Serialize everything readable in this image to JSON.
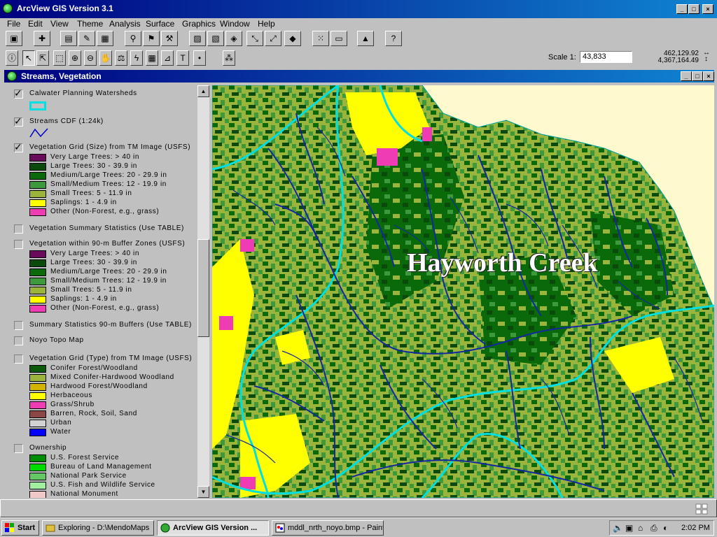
{
  "app": {
    "title": "ArcView GIS Version 3.1",
    "min": "_",
    "max": "□",
    "close": "×"
  },
  "menu": [
    "File",
    "Edit",
    "View",
    "Theme",
    "Analysis",
    "Surface",
    "Graphics",
    "Window",
    "Help"
  ],
  "toolbar": {
    "scale_label": "Scale 1:",
    "scale_value": "43,833",
    "coord_x": "462,129.92",
    "coord_y": "4,367,164.49"
  },
  "view": {
    "title": "Streams, Vegetation",
    "map_label": "Hayworth Creek",
    "themes": [
      {
        "name": "Calwater Planning Watersheds",
        "checked": true
      },
      {
        "name": "Streams CDF (1:24k)",
        "checked": true
      },
      {
        "name": "Vegetation Grid (Size) from TM Image (USFS)",
        "checked": true,
        "legend": [
          {
            "label": "Very Large Trees: > 40  in",
            "color": "#6a0a5a"
          },
          {
            "label": "Large Trees: 30 - 39.9 in",
            "color": "#0a4a0a"
          },
          {
            "label": "Medium/Large Trees: 20 - 29.9 in",
            "color": "#0a6a0a"
          },
          {
            "label": "Small/Medium Trees: 12 - 19.9 in",
            "color": "#3c9a3c"
          },
          {
            "label": "Small Trees: 5 - 11.9 in",
            "color": "#9ab43c"
          },
          {
            "label": "Saplings: 1 - 4.9 in",
            "color": "#ffff00"
          },
          {
            "label": "Other (Non-Forest, e.g., grass)",
            "color": "#f03cb4"
          }
        ]
      },
      {
        "name": "Vegetation Summary Statistics (Use TABLE)",
        "checked": false
      },
      {
        "name": "Vegetation within 90-m Buffer Zones (USFS)",
        "checked": false,
        "legend": [
          {
            "label": "Very Large Trees: > 40  in",
            "color": "#6a0a5a"
          },
          {
            "label": "Large Trees: 30 - 39.9 in",
            "color": "#0a4a0a"
          },
          {
            "label": "Medium/Large Trees: 20 - 29.9 in",
            "color": "#0a6a0a"
          },
          {
            "label": "Small/Medium Trees: 12 - 19.9 in",
            "color": "#3c9a3c"
          },
          {
            "label": "Small Trees: 5 - 11.9 in",
            "color": "#9ab43c"
          },
          {
            "label": "Saplings: 1 - 4.9 in",
            "color": "#ffff00"
          },
          {
            "label": "Other (Non-Forest, e.g., grass)",
            "color": "#f03cb4"
          }
        ]
      },
      {
        "name": "Summary Statistics 90-m Buffers (Use TABLE)",
        "checked": false
      },
      {
        "name": "Noyo Topo Map",
        "checked": false
      },
      {
        "name": "Vegetation Grid (Type) from TM Image (USFS)",
        "checked": false,
        "legend": [
          {
            "label": "Conifer Forest/Woodland",
            "color": "#0a5a0a"
          },
          {
            "label": "Mixed Conifer-Hardwood Woodland",
            "color": "#9ab43c"
          },
          {
            "label": "Hardwood Forest/Woodland",
            "color": "#d2b400"
          },
          {
            "label": "Herbaceous",
            "color": "#ffff00"
          },
          {
            "label": "Grass/Shrub",
            "color": "#f03cb4"
          },
          {
            "label": "Barren, Rock, Soil, Sand",
            "color": "#8c4646"
          },
          {
            "label": "Urban",
            "color": "#d2d2d2"
          },
          {
            "label": "Water",
            "color": "#0000ff"
          }
        ]
      },
      {
        "name": "Ownership",
        "checked": false,
        "legend": [
          {
            "label": "U.S. Forest Service",
            "color": "#008c00"
          },
          {
            "label": "Bureau of Land Management",
            "color": "#00dc00"
          },
          {
            "label": "National Park Service",
            "color": "#64c864"
          },
          {
            "label": "U.S. Fish and Wildlife Service",
            "color": "#a0f0a0"
          },
          {
            "label": "National Monument",
            "color": "#f0c8c8"
          }
        ]
      }
    ]
  },
  "taskbar": {
    "start": "Start",
    "tasks": [
      {
        "label": "Exploring - D:\\MendoMaps"
      },
      {
        "label": "ArcView GIS Version ..."
      },
      {
        "label": "mddl_nrth_noyo.bmp - Paint"
      }
    ],
    "clock": "2:02 PM"
  }
}
